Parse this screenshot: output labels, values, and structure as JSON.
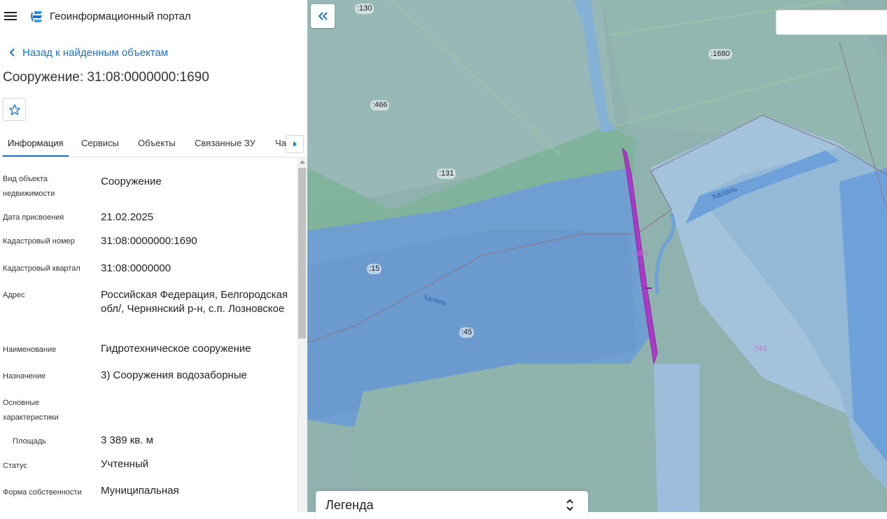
{
  "header": {
    "menu_icon": "hamburger-menu-icon",
    "logo_icon": "portal-logo-icon",
    "title": "Геоинформационный портал"
  },
  "back_link": {
    "icon": "chevron-left-icon",
    "label": "Назад к найденным объектам"
  },
  "object": {
    "title": "Сооружение: 31:08:0000000:1690",
    "favorite_icon": "star-outline-icon"
  },
  "tabs": [
    {
      "label": "Информация",
      "active": true
    },
    {
      "label": "Сервисы",
      "active": false
    },
    {
      "label": "Объекты",
      "active": false
    },
    {
      "label": "Связанные ЗУ",
      "active": false
    },
    {
      "label": "Ча",
      "active": false
    }
  ],
  "tabs_scroll_icon": "caret-right-icon",
  "info": [
    {
      "label": "Вид объекта недвижимости",
      "value": "Сооружение"
    },
    {
      "label": "Дата присвоения",
      "value": "21.02.2025"
    },
    {
      "label": "Кадастровый номер",
      "value": "31:08:0000000:1690"
    },
    {
      "label": "Кадастровый квартал",
      "value": "31:08:0000000"
    },
    {
      "label": "Адрес",
      "value": "Российская Федерация, Белгородская обл/, Чернянский р-н, с.п. Лозновское"
    },
    {
      "label": "Наименование",
      "value": "Гидротехническое сооружение"
    },
    {
      "label": "Назначение",
      "value": "3) Сооружения водозаборные"
    },
    {
      "label": "Основные характеристики",
      "value": ""
    },
    {
      "label": "Площадь",
      "value": "3 389 кв. м"
    },
    {
      "label": "Статус",
      "value": "Учтенный"
    },
    {
      "label": "Форма собственности",
      "value": "Муниципальная"
    }
  ],
  "map": {
    "collapse_icon": "double-chevron-left-icon",
    "search_placeholder": "",
    "parcel_labels": [
      ":130",
      ":1680",
      ":466",
      ":131",
      ":15",
      ":45"
    ],
    "river_labels": [
      "Халань",
      "Халань"
    ],
    "highlight_label": "1690",
    "other_label": "744",
    "legend_title": "Легенда",
    "legend_icon": "expand-collapse-icon"
  },
  "colors": {
    "accent": "#1a73c8",
    "selected_object": "#b02fc8",
    "water": "#6c9fd6",
    "land": "#8fb2ae"
  }
}
